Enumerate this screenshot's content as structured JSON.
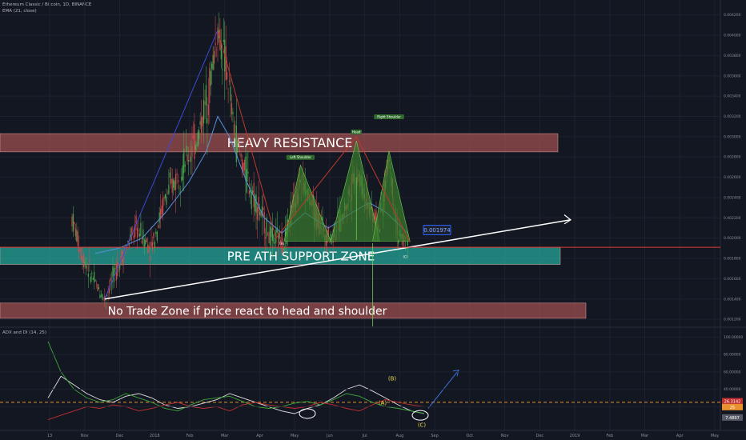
{
  "header": {
    "symbol_line": "Ethereum Classic / Bitcoin, 1D, BINANCE",
    "ema_line": "EMA (21, close)",
    "adx_line": "ADX and DI (14, 25)"
  },
  "chart_data": [
    {
      "type": "candlestick",
      "title": "Ethereum Classic / Bitcoin, 1D, BINANCE",
      "indicator": "EMA (21, close)",
      "x_tick_labels": [
        "13",
        "Nov",
        "Dec",
        "2018",
        "Feb",
        "Mar",
        "Apr",
        "May",
        "Jun",
        "Jul",
        "Aug",
        "Sep",
        "Oct",
        "Nov",
        "Dec",
        "2019",
        "Feb",
        "Mar",
        "Apr",
        "May"
      ],
      "y_tick_labels": [
        "0.004200",
        "0.004000",
        "0.003800",
        "0.003600",
        "0.003400",
        "0.003200",
        "0.003000",
        "0.002800",
        "0.002600",
        "0.002400",
        "0.002200",
        "0.002000",
        "0.001800",
        "0.001600",
        "0.001400",
        "0.001200"
      ],
      "ylim": [
        0.00113,
        0.0043
      ],
      "price_path": [
        {
          "x": 0,
          "y": 0.0022
        },
        {
          "x": 8,
          "y": 0.00185
        },
        {
          "x": 20,
          "y": 0.00155
        },
        {
          "x": 28,
          "y": 0.0014
        },
        {
          "x": 40,
          "y": 0.00175
        },
        {
          "x": 55,
          "y": 0.0021
        },
        {
          "x": 68,
          "y": 0.0019
        },
        {
          "x": 80,
          "y": 0.0024
        },
        {
          "x": 95,
          "y": 0.0027
        },
        {
          "x": 108,
          "y": 0.003
        },
        {
          "x": 118,
          "y": 0.0035
        },
        {
          "x": 125,
          "y": 0.00405
        },
        {
          "x": 132,
          "y": 0.0037
        },
        {
          "x": 140,
          "y": 0.003
        },
        {
          "x": 150,
          "y": 0.0026
        },
        {
          "x": 160,
          "y": 0.0023
        },
        {
          "x": 170,
          "y": 0.002
        },
        {
          "x": 182,
          "y": 0.00198
        },
        {
          "x": 196,
          "y": 0.0026
        },
        {
          "x": 210,
          "y": 0.0022
        },
        {
          "x": 222,
          "y": 0.002
        },
        {
          "x": 232,
          "y": 0.0022
        },
        {
          "x": 244,
          "y": 0.00268
        },
        {
          "x": 252,
          "y": 0.0024
        },
        {
          "x": 264,
          "y": 0.0021
        },
        {
          "x": 272,
          "y": 0.0028
        },
        {
          "x": 280,
          "y": 0.002
        },
        {
          "x": 288,
          "y": 0.00197
        }
      ],
      "ema_path": [
        {
          "x": 20,
          "y": 0.00185
        },
        {
          "x": 40,
          "y": 0.0019
        },
        {
          "x": 60,
          "y": 0.002
        },
        {
          "x": 80,
          "y": 0.00225
        },
        {
          "x": 100,
          "y": 0.00255
        },
        {
          "x": 115,
          "y": 0.00285
        },
        {
          "x": 125,
          "y": 0.0032
        },
        {
          "x": 135,
          "y": 0.003
        },
        {
          "x": 150,
          "y": 0.00255
        },
        {
          "x": 165,
          "y": 0.0022
        },
        {
          "x": 180,
          "y": 0.00205
        },
        {
          "x": 200,
          "y": 0.00225
        },
        {
          "x": 220,
          "y": 0.0021
        },
        {
          "x": 240,
          "y": 0.00225
        },
        {
          "x": 255,
          "y": 0.00235
        },
        {
          "x": 270,
          "y": 0.00225
        },
        {
          "x": 288,
          "y": 0.00205
        }
      ],
      "current_price_label": "0.001974",
      "zones": [
        {
          "name": "heavy-resistance",
          "label": "HEAVY RESISTANCE",
          "y_top": 0.00303,
          "y_bottom": 0.00285,
          "color": "#9c4f4f"
        },
        {
          "name": "pre-ath-support",
          "label": "PRE ATH SUPPORT ZONE",
          "y_top": 0.00191,
          "y_bottom": 0.00174,
          "color": "#26a69a"
        },
        {
          "name": "no-trade",
          "label": "No Trade Zone if price react to head and shoulder",
          "y_top": 0.00136,
          "y_bottom": 0.00121,
          "color": "#9c4f4f"
        }
      ],
      "pattern_labels": [
        "Left Shoulder",
        "Head",
        "Right Shoulder",
        "(A)",
        "(C)"
      ]
    },
    {
      "type": "line",
      "title": "ADX and DI (14, 25)",
      "y_tick_labels": [
        "100.00000",
        "80.00000",
        "60.00000",
        "40.00000",
        "20.00000"
      ],
      "ylim": [
        0,
        105
      ],
      "threshold": 25,
      "series": [
        {
          "name": "ADX",
          "color": "#e0e0e0",
          "values": [
            30,
            55,
            45,
            35,
            28,
            25,
            32,
            35,
            30,
            22,
            18,
            20,
            24,
            28,
            35,
            30,
            25,
            20,
            15,
            12,
            18,
            22,
            30,
            40,
            45,
            38,
            30,
            22,
            15,
            12
          ]
        },
        {
          "name": "DI+",
          "color": "#3fa53b",
          "values": [
            95,
            60,
            40,
            30,
            25,
            28,
            35,
            30,
            25,
            18,
            15,
            22,
            28,
            30,
            32,
            26,
            20,
            18,
            20,
            24,
            26,
            22,
            28,
            35,
            32,
            25,
            20,
            18,
            15,
            12
          ]
        },
        {
          "name": "DI-",
          "color": "#c22f2f",
          "values": [
            5,
            10,
            15,
            20,
            18,
            22,
            20,
            15,
            18,
            22,
            25,
            20,
            18,
            20,
            15,
            22,
            25,
            22,
            20,
            18,
            20,
            25,
            22,
            18,
            15,
            22,
            28,
            25,
            22,
            20
          ]
        }
      ],
      "annotations": [
        "(A)",
        "(B)",
        "(C)"
      ],
      "value_labels": [
        "26.3142",
        "25",
        "7.4897"
      ]
    }
  ]
}
